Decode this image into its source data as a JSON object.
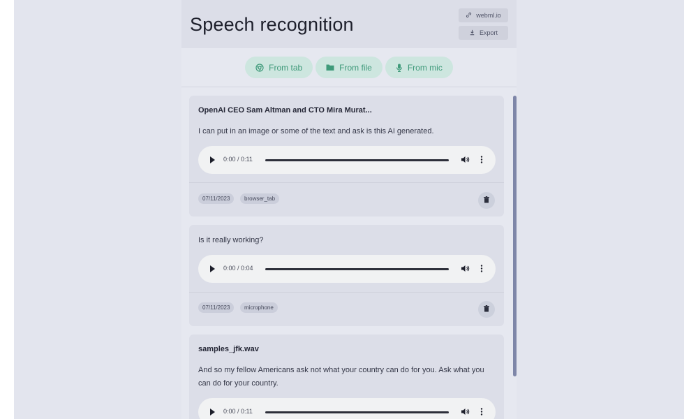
{
  "header": {
    "title": "Speech recognition",
    "link_label": "webml.io",
    "export_label": "Export"
  },
  "sources": [
    {
      "label": "From tab",
      "icon": "chrome-icon"
    },
    {
      "label": "From file",
      "icon": "folder-icon"
    },
    {
      "label": "From mic",
      "icon": "microphone-icon"
    }
  ],
  "colors": {
    "accent_bg": "#cde6df",
    "accent_fg": "#3f9a7a",
    "card_bg": "#dcdee8",
    "scrollbar": "#7e86a8"
  },
  "items": [
    {
      "title": "OpenAI CEO Sam Altman and CTO Mira Murat...",
      "text": "I can put in an image or some of the text and ask is this AI generated.",
      "time": "0:00 / 0:11",
      "date": "07/11/2023",
      "source": "browser_tab"
    },
    {
      "title": "",
      "text": "Is it really working?",
      "time": "0:00 / 0:04",
      "date": "07/11/2023",
      "source": "microphone"
    },
    {
      "title": "samples_jfk.wav",
      "text": "And so my fellow Americans ask not what your country can do for you. Ask what you can do for your country.",
      "time": "0:00 / 0:11",
      "date": "",
      "source": ""
    }
  ]
}
